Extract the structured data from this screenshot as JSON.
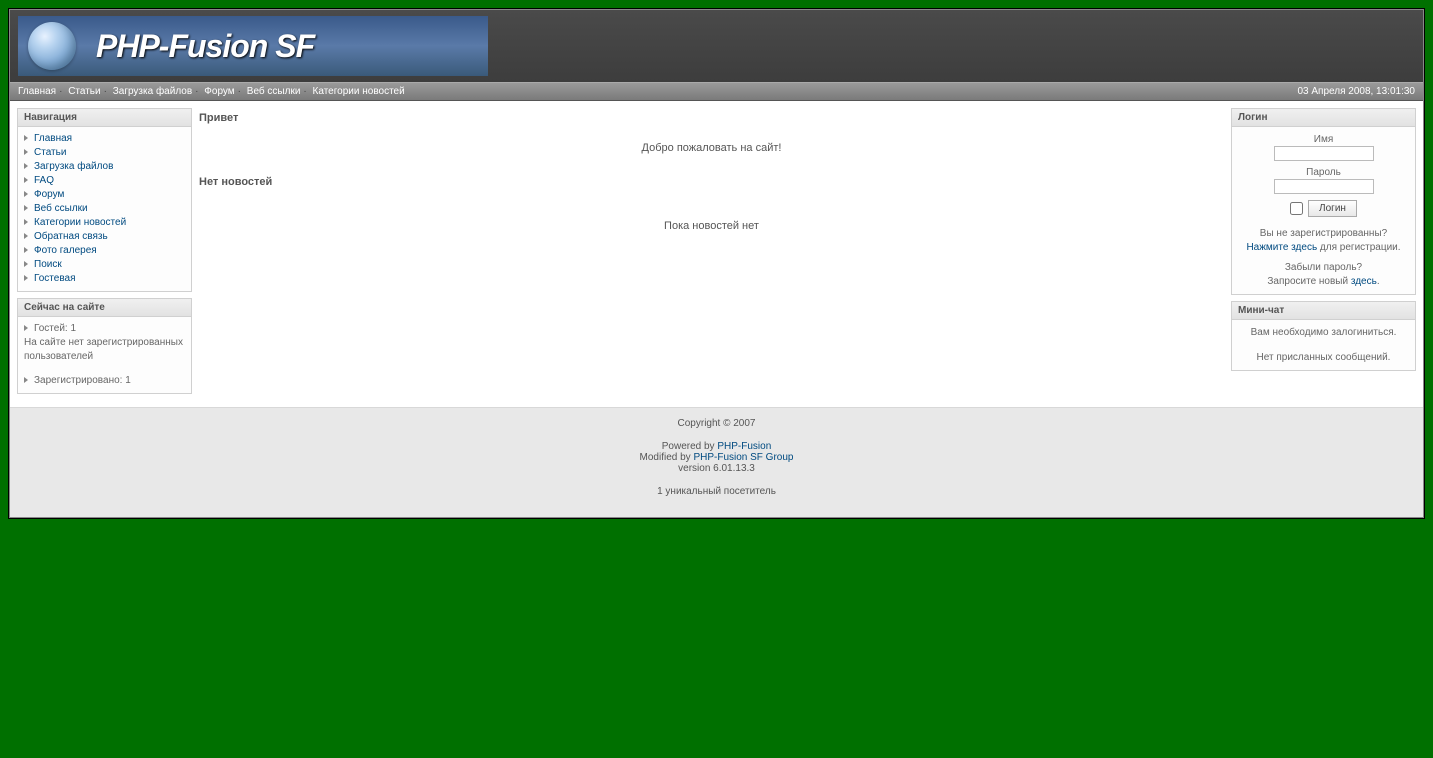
{
  "logo_text": "PHP-Fusion SF",
  "topnav": {
    "items": [
      "Главная",
      "Статьи",
      "Загрузка файлов",
      "Форум",
      "Веб ссылки",
      "Категории новостей"
    ],
    "datetime": "03 Апреля 2008, 13:01:30"
  },
  "sidebar": {
    "nav_title": "Навигация",
    "nav_items": [
      "Главная",
      "Статьи",
      "Загрузка файлов",
      "FAQ",
      "Форум",
      "Веб ссылки",
      "Категории новостей",
      "Обратная связь",
      "Фото галерея",
      "Поиск",
      "Гостевая"
    ],
    "online_title": "Сейчас на сайте",
    "online_guests": "Гостей: 1",
    "online_users": "На сайте нет зарегистрированных пользователей",
    "online_registered": "Зарегистрировано: 1"
  },
  "content": {
    "welcome_title": "Привет",
    "welcome_text": "Добро пожаловать на сайт!",
    "nonews_title": "Нет новостей",
    "nonews_text": "Пока новостей нет"
  },
  "login": {
    "title": "Логин",
    "name_label": "Имя",
    "password_label": "Пароль",
    "button": "Логин",
    "not_registered": "Вы не зарегистрированны?",
    "click_here": "Нажмите здесь",
    "for_register": " для регистрации.",
    "forgot": "Забыли пароль?",
    "request_new": "Запросите новый ",
    "here": "здесь",
    "dot": "."
  },
  "minichat": {
    "title": "Мини-чат",
    "need_login": "Вам необходимо залогиниться.",
    "no_messages": "Нет присланных сообщений."
  },
  "footer": {
    "copyright": "Copyright © 2007",
    "powered": "Powered by ",
    "powered_link": "PHP-Fusion",
    "modified": "Modified by ",
    "modified_link": "PHP-Fusion SF Group",
    "version": "version 6.01.13.3",
    "visitors": "1 уникальный посетитель"
  }
}
